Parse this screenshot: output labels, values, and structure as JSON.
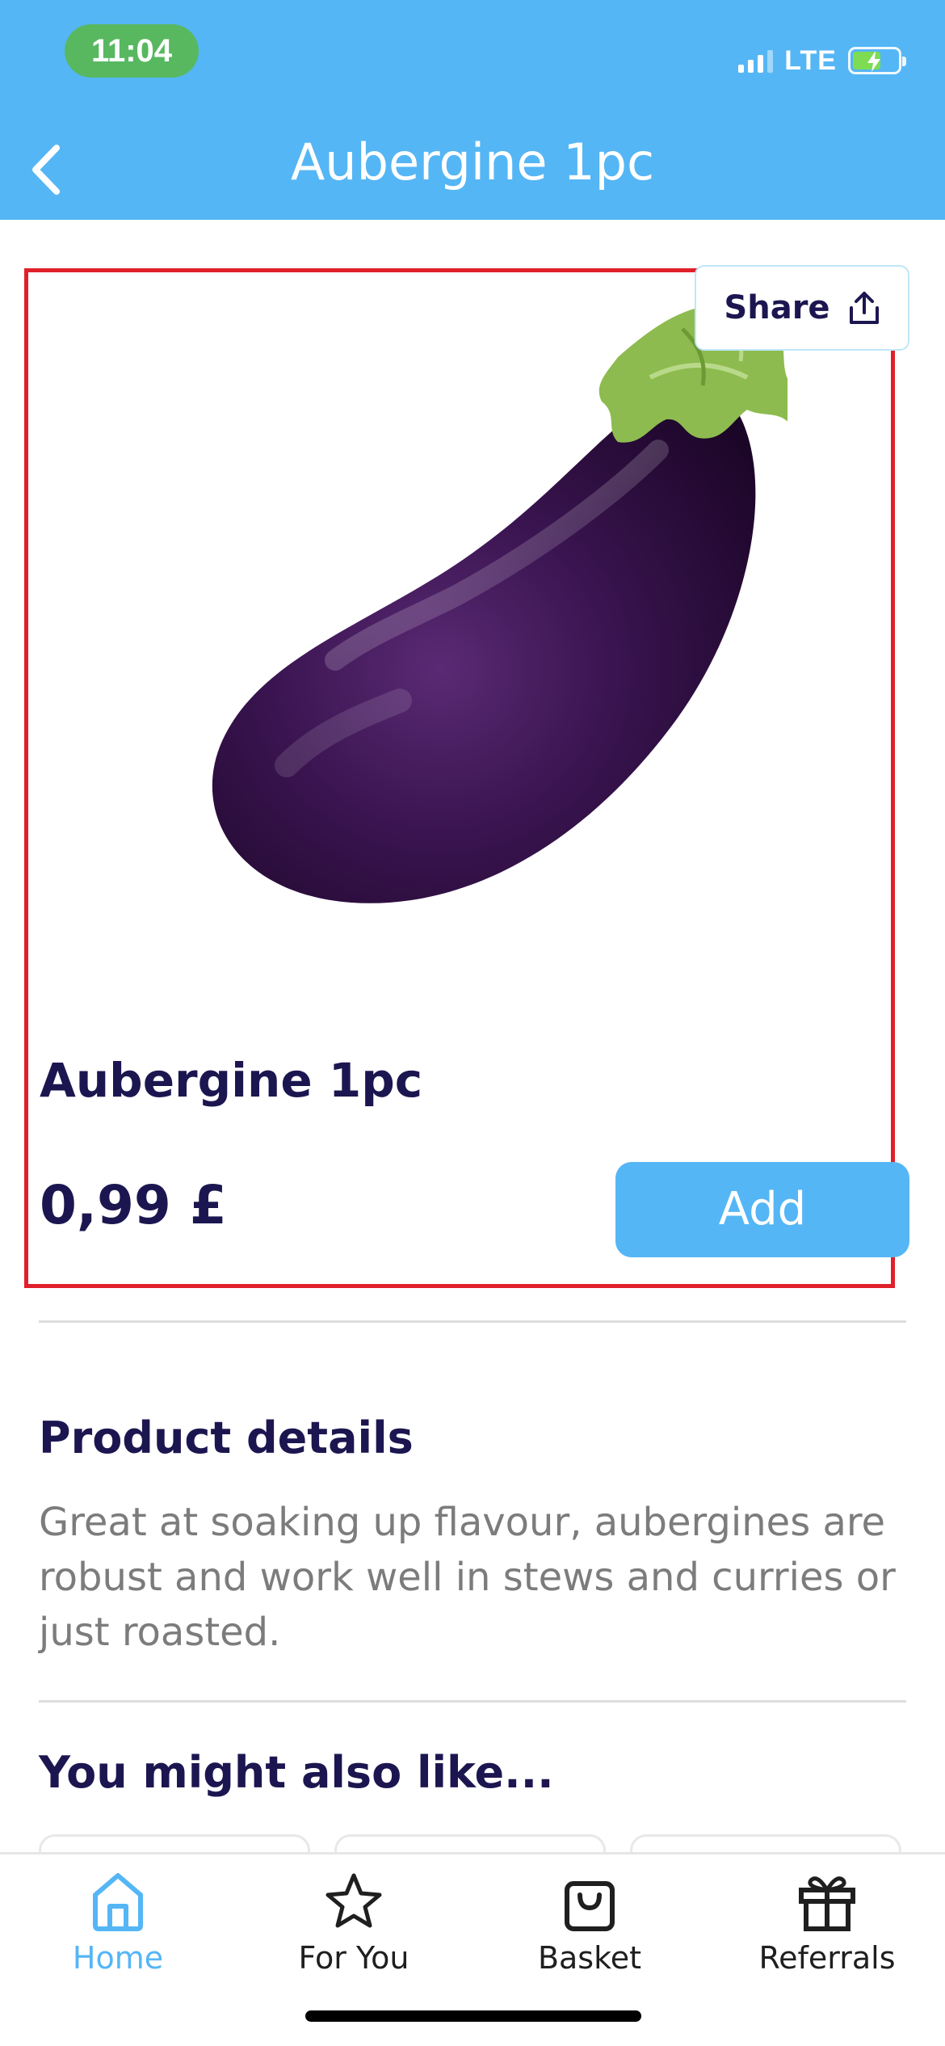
{
  "status_bar": {
    "time": "11:04",
    "network": "LTE",
    "time_pill_color": "#58b860",
    "battery_fill_color": "#7ddc52"
  },
  "header": {
    "title": "Aubergine 1pc",
    "back_icon": "chevron-left-icon",
    "background": "#55b6f5"
  },
  "product": {
    "image": "aubergine-image",
    "share_label": "Share",
    "share_icon": "share-upload-icon",
    "name": "Aubergine 1pc",
    "price": "0,99 £",
    "add_label": "Add",
    "highlight_color": "#e0202a"
  },
  "details": {
    "title": "Product details",
    "text": "Great at soaking up flavour, aubergines are robust and work well in stews and curries or just roasted."
  },
  "recommendations": {
    "title": "You might also like..."
  },
  "bottom_nav": {
    "items": [
      {
        "label": "Home",
        "icon": "home-icon",
        "active": true
      },
      {
        "label": "For You",
        "icon": "star-icon",
        "active": false
      },
      {
        "label": "Basket",
        "icon": "basket-icon",
        "active": false
      },
      {
        "label": "Referrals",
        "icon": "gift-icon",
        "active": false
      }
    ],
    "active_color": "#55b6f5"
  }
}
